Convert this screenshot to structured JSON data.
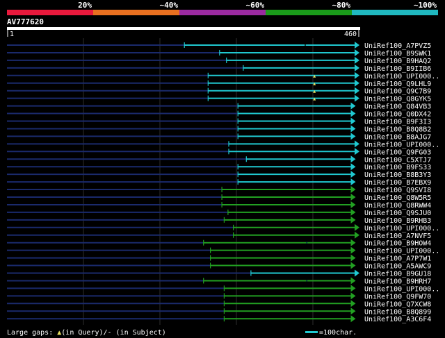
{
  "identity_scale": {
    "ticks": [
      "20%",
      "~40%",
      "~60%",
      "~80%",
      "~100%"
    ],
    "colors": [
      "#e8193c",
      "#e87020",
      "#9a2aa0",
      "#1a9a1a",
      "#20b8c0"
    ]
  },
  "query": {
    "name": "AV777620",
    "start_label": "1",
    "end_label": "460",
    "length": 460
  },
  "style": {
    "backbone_color": "#1a2a6c",
    "grid_color": "#2e2e2e",
    "cyan": "#20c8d0",
    "green": "#22a022",
    "gap_marker_color": "#e8e060",
    "label_color": "#ffffff"
  },
  "hits": [
    {
      "name": "UniRef100_A7PVZ5",
      "start": 232,
      "end": 460,
      "color": "cyan",
      "gap_at": 390
    },
    {
      "name": "UniRef100_B9SWK1",
      "start": 278,
      "end": 460,
      "color": "cyan"
    },
    {
      "name": "UniRef100_B9HAQ2",
      "start": 287,
      "end": 460,
      "color": "cyan"
    },
    {
      "name": "UniRef100_B9IIB6",
      "start": 309,
      "end": 460,
      "color": "cyan"
    },
    {
      "name": "UniRef100_UPI000..",
      "start": 263,
      "end": 460,
      "color": "cyan",
      "query_gap_at": 402
    },
    {
      "name": "UniRef100_Q9LHL9",
      "start": 263,
      "end": 460,
      "color": "cyan",
      "query_gap_at": 402
    },
    {
      "name": "UniRef100_Q9C7B9",
      "start": 263,
      "end": 460,
      "color": "cyan",
      "query_gap_at": 402
    },
    {
      "name": "UniRef100_Q8GYK5",
      "start": 263,
      "end": 460,
      "color": "cyan",
      "query_gap_at": 402
    },
    {
      "name": "UniRef100_Q84VB3",
      "start": 302,
      "end": 455,
      "color": "cyan"
    },
    {
      "name": "UniRef100_Q0DX42",
      "start": 302,
      "end": 455,
      "color": "cyan"
    },
    {
      "name": "UniRef100_B9F3I3",
      "start": 302,
      "end": 455,
      "color": "cyan"
    },
    {
      "name": "UniRef100_B8Q8B2",
      "start": 302,
      "end": 455,
      "color": "cyan"
    },
    {
      "name": "UniRef100_B8AJG7",
      "start": 302,
      "end": 455,
      "color": "cyan"
    },
    {
      "name": "UniRef100_UPI000..",
      "start": 290,
      "end": 460,
      "color": "cyan"
    },
    {
      "name": "UniRef100_Q9FG03",
      "start": 290,
      "end": 460,
      "color": "cyan"
    },
    {
      "name": "UniRef100_C5XTJ7",
      "start": 313,
      "end": 455,
      "color": "cyan"
    },
    {
      "name": "UniRef100_B9FS33",
      "start": 302,
      "end": 455,
      "color": "cyan"
    },
    {
      "name": "UniRef100_B8B3Y3",
      "start": 302,
      "end": 455,
      "color": "cyan"
    },
    {
      "name": "UniRef100_B7EBX9",
      "start": 302,
      "end": 455,
      "color": "cyan"
    },
    {
      "name": "UniRef100_Q9SVI8",
      "start": 281,
      "end": 455,
      "color": "green"
    },
    {
      "name": "UniRef100_Q8W5R5",
      "start": 281,
      "end": 455,
      "color": "green"
    },
    {
      "name": "UniRef100_Q8RWW4",
      "start": 281,
      "end": 455,
      "color": "green"
    },
    {
      "name": "UniRef100_Q9SJU0",
      "start": 289,
      "end": 455,
      "color": "green"
    },
    {
      "name": "UniRef100_B9RHB3",
      "start": 284,
      "end": 455,
      "color": "green"
    },
    {
      "name": "UniRef100_UPI000..",
      "start": 296,
      "end": 460,
      "color": "green"
    },
    {
      "name": "UniRef100_A7NVF5",
      "start": 296,
      "end": 460,
      "color": "green"
    },
    {
      "name": "UniRef100_B9HOW4",
      "start": 257,
      "end": 455,
      "color": "green",
      "gap_at": 392
    },
    {
      "name": "UniRef100_UPI000..",
      "start": 266,
      "end": 455,
      "color": "green"
    },
    {
      "name": "UniRef100_A7P7W1",
      "start": 266,
      "end": 455,
      "color": "green"
    },
    {
      "name": "UniRef100_A5AWC9",
      "start": 266,
      "end": 455,
      "color": "green"
    },
    {
      "name": "UniRef100_B9GU18",
      "start": 319,
      "end": 460,
      "color": "cyan"
    },
    {
      "name": "UniRef100_B9HRH7",
      "start": 257,
      "end": 455,
      "color": "green",
      "gap_at": 392
    },
    {
      "name": "UniRef100_UPI000..",
      "start": 284,
      "end": 455,
      "color": "green"
    },
    {
      "name": "UniRef100_Q9FW70",
      "start": 284,
      "end": 455,
      "color": "green"
    },
    {
      "name": "UniRef100_Q7XCW8",
      "start": 284,
      "end": 455,
      "color": "green"
    },
    {
      "name": "UniRef100_B8Q899",
      "start": 284,
      "end": 455,
      "color": "green"
    },
    {
      "name": "UniRef100_A3C6F4",
      "start": 284,
      "end": 455,
      "color": "green"
    }
  ],
  "footer": {
    "legend_prefix": "Large gaps: ",
    "query_marker": "▲",
    "legend_middle": "(in Query)/- (in Subject)",
    "scale_text": "=100char."
  }
}
